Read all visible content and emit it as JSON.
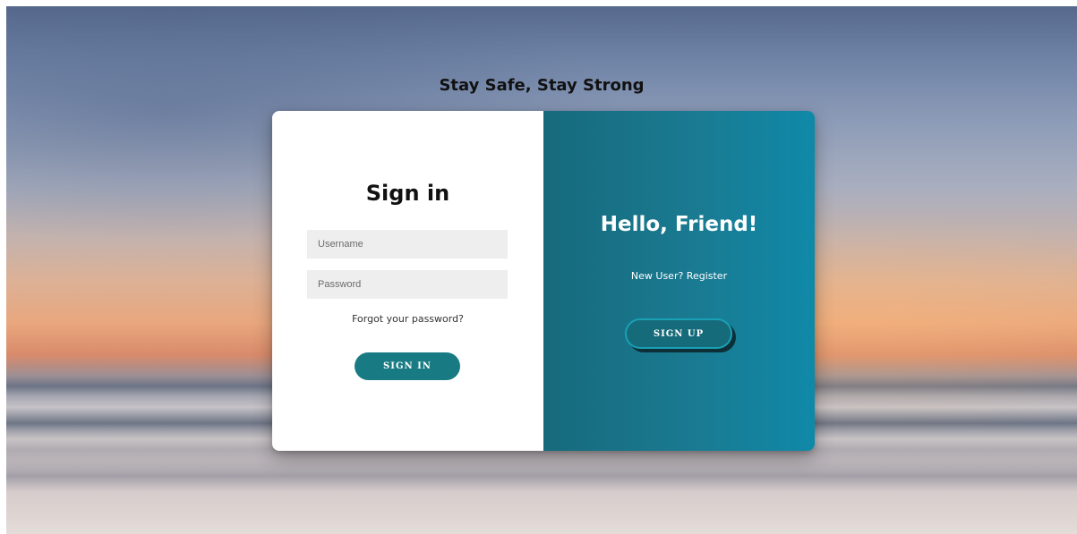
{
  "page": {
    "tagline": "Stay Safe, Stay Strong"
  },
  "signin": {
    "title": "Sign in",
    "username_placeholder": "Username",
    "password_placeholder": "Password",
    "forgot_link": "Forgot your password?",
    "button_label": "SIGN IN"
  },
  "signup_panel": {
    "title": "Hello, Friend!",
    "register_text": "New User? Register",
    "button_label": "SIGN UP"
  },
  "colors": {
    "primary_teal": "#187b84",
    "panel_gradient_start": "#166a7c",
    "panel_gradient_end": "#0f89a8",
    "input_background": "#eeeeee"
  }
}
